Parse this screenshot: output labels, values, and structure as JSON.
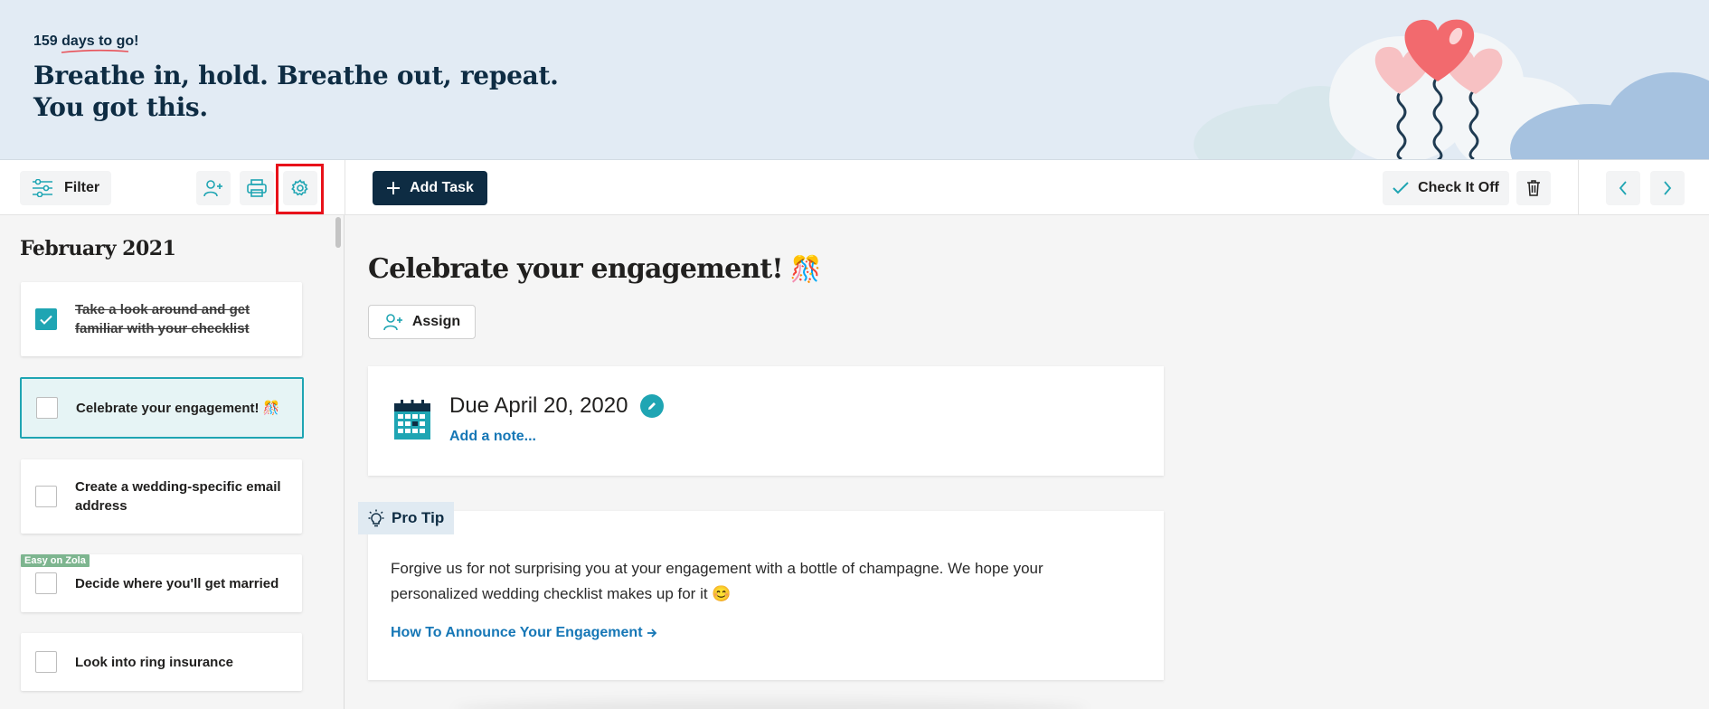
{
  "hero": {
    "countdown_number": "159",
    "countdown_text": "days to go!",
    "title_line1": "Breathe in, hold. Breathe out, repeat.",
    "title_line2": "You got this."
  },
  "toolbar": {
    "filter_label": "Filter",
    "icons": [
      "filter-sliders-icon",
      "add-person-icon",
      "printer-icon",
      "gear-icon",
      "plus-icon",
      "checkmark-icon",
      "trash-icon",
      "chevron-left-icon",
      "chevron-right-icon"
    ],
    "add_task_label": "Add Task",
    "check_off_label": "Check It Off"
  },
  "sidebar": {
    "month": "February 2021",
    "tasks": [
      {
        "label": "Take a look around and get familiar with your checklist",
        "done": true,
        "active": false,
        "badge": ""
      },
      {
        "label": "Celebrate your engagement! 🎊",
        "done": false,
        "active": true,
        "badge": ""
      },
      {
        "label": "Create a wedding-specific email address",
        "done": false,
        "active": false,
        "badge": ""
      },
      {
        "label": "Decide where you'll get married",
        "done": false,
        "active": false,
        "badge": "Easy on Zola"
      },
      {
        "label": "Look into ring insurance",
        "done": false,
        "active": false,
        "badge": ""
      }
    ]
  },
  "main": {
    "title": "Celebrate your engagement!",
    "title_emoji": "🎊",
    "assign_label": "Assign",
    "due_text": "Due April 20, 2020",
    "add_note": "Add a note...",
    "pro_tip_label": "Pro Tip",
    "tip_body": "Forgive us for not surprising you at your engagement with a bottle of champagne. We hope your personalized wedding checklist makes up for it 😊",
    "tip_link": "How To Announce Your Engagement"
  },
  "colors": {
    "brand_navy": "#0e2c43",
    "teal": "#1fa5b3",
    "link_blue": "#1677b6",
    "hero_bg": "#e2ebf4",
    "highlight_red": "#e8111a"
  }
}
